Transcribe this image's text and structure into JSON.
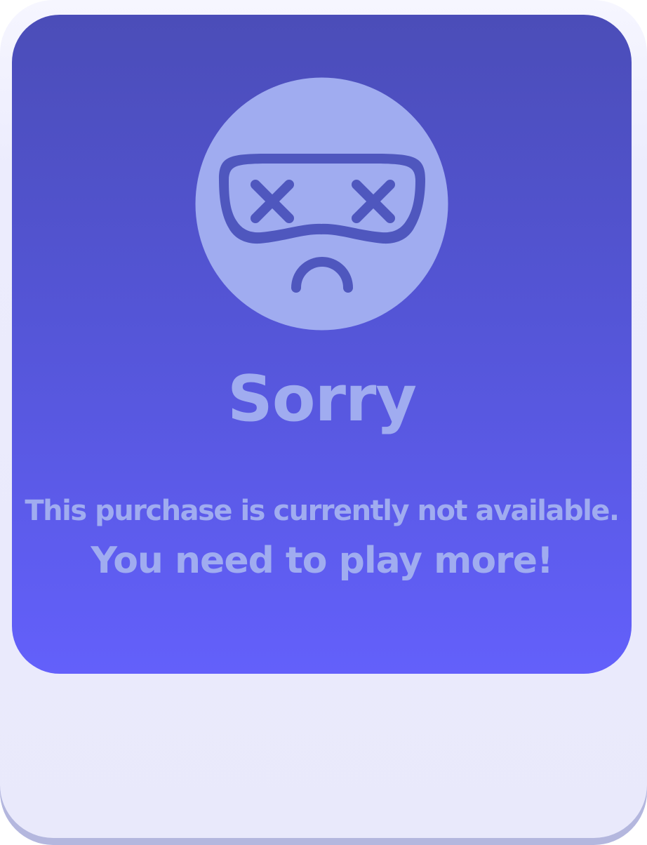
{
  "dialog": {
    "title": "Sorry",
    "message_line1": "This purchase is currently not available.",
    "message_line2": "You need to play more!"
  },
  "icons": {
    "face": "sad-ninja-face-icon"
  },
  "colors": {
    "panel_top": "#4b4db8",
    "panel_bottom": "#6360fb",
    "text_and_face": "#a0acf0",
    "face_features": "#4f57be",
    "card_background": "#e9e9fb",
    "card_border_shadow": "#b4b7de"
  }
}
